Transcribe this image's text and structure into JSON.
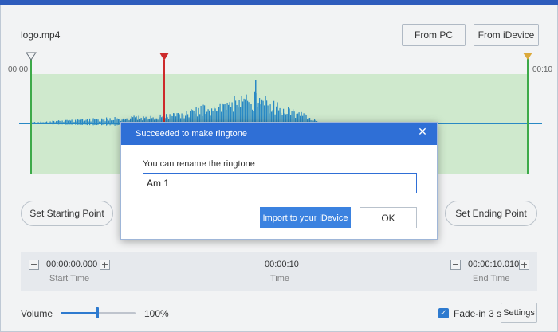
{
  "file": {
    "name": "logo.mp4"
  },
  "source_buttons": {
    "from_pc": "From PC",
    "from_idevice": "From iDevice"
  },
  "timeline": {
    "start_label": "00:00",
    "end_label": "00:10"
  },
  "markers": {
    "set_start": "Set Starting Point",
    "set_end": "Set Ending Point"
  },
  "time_panel": {
    "start_value": "00:00:00.000",
    "start_label": "Start Time",
    "duration_value": "00:00:10",
    "duration_label": "Time",
    "end_value": "00:00:10.010",
    "end_label": "End Time",
    "minus": "−",
    "plus": "+"
  },
  "volume": {
    "label": "Volume",
    "value": "100%",
    "level": 1.0
  },
  "fade": {
    "label": "Fade-in 3 s",
    "checked": true,
    "check_glyph": "✓"
  },
  "settings_label": "Settings",
  "dialog": {
    "title": "Succeeded to make ringtone",
    "close_glyph": "✕",
    "prompt": "You can rename the ringtone",
    "input_value": "Am 1",
    "import_label": "Import to your iDevice",
    "ok_label": "OK"
  },
  "colors": {
    "accent": "#2f6fd6",
    "waveform": "#2a8fcc",
    "selection": "#daf5d6",
    "playhead": "#d82a2a",
    "end_marker": "#e8b13a"
  }
}
